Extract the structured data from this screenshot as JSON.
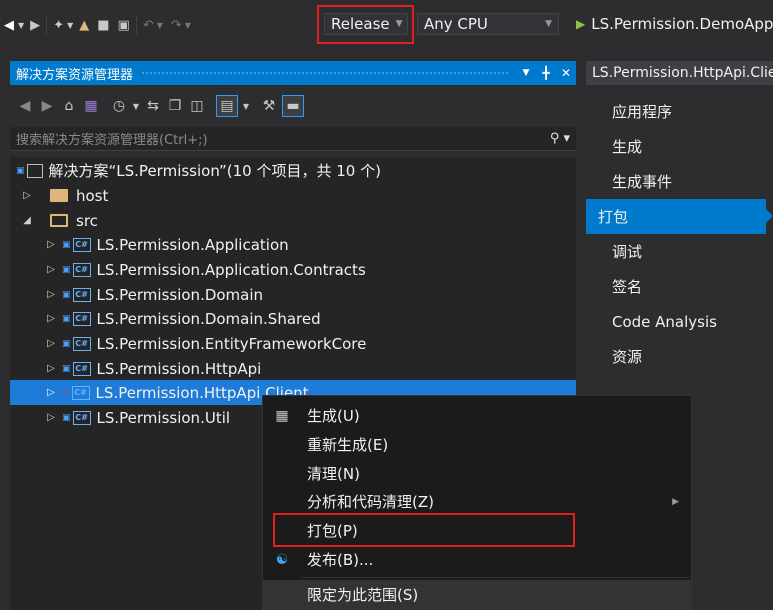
{
  "toolbar": {
    "config": "Release",
    "platform": "Any CPU",
    "startup_project": "LS.Permission.DemoApp"
  },
  "solution_explorer": {
    "title": "解决方案资源管理器",
    "search_placeholder": "搜索解决方案资源管理器(Ctrl+;)",
    "solution": "解决方案“LS.Permission”(10 个项目，共 10 个)",
    "folders": {
      "host": "host",
      "src": "src"
    },
    "projects": [
      "LS.Permission.Application",
      "LS.Permission.Application.Contracts",
      "LS.Permission.Domain",
      "LS.Permission.Domain.Shared",
      "LS.Permission.EntityFrameworkCore",
      "LS.Permission.HttpApi",
      "LS.Permission.HttpApi.Client",
      "LS.Permission.Util"
    ],
    "selected_project": "LS.Permission.HttpApi.Client"
  },
  "properties": {
    "tab_title": "LS.Permission.HttpApi.Client",
    "nav": [
      "应用程序",
      "生成",
      "生成事件",
      "打包",
      "调试",
      "签名",
      "Code Analysis",
      "资源"
    ],
    "active": "打包"
  },
  "context_menu": {
    "items": [
      "生成(U)",
      "重新生成(E)",
      "清理(N)",
      "分析和代码清理(Z)",
      "打包(P)",
      "发布(B)...",
      "限定为此范围(S)"
    ]
  },
  "colors": {
    "accent": "#007acc",
    "highlight_box": "#e02020",
    "selection": "#1e7bd7"
  }
}
